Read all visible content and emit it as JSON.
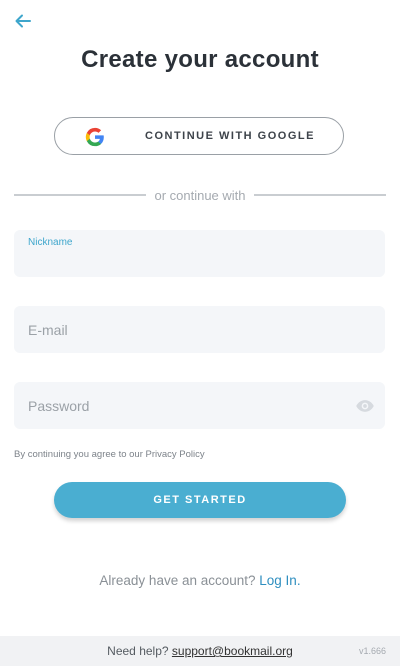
{
  "header": {
    "back_icon": "arrow-left-icon",
    "title": "Create your account"
  },
  "google_button": {
    "icon": "google-logo-icon",
    "label": "CONTINUE WITH GOOGLE"
  },
  "divider": {
    "text": "or continue with"
  },
  "form": {
    "nickname": {
      "label": "Nickname",
      "value": ""
    },
    "email": {
      "placeholder": "E-mail",
      "value": ""
    },
    "password": {
      "placeholder": "Password",
      "value": "",
      "toggle_icon": "eye-icon"
    },
    "terms_text": "By continuing you agree to our Privacy Policy"
  },
  "cta": {
    "label": "GET STARTED"
  },
  "signin": {
    "prompt": "Already have an account?",
    "link": "Log In."
  },
  "footer": {
    "help_text": "Need help?",
    "help_link": "support@bookmail.org",
    "version": "v1.666"
  },
  "colors": {
    "accent": "#4aaed1",
    "link": "#2f8fc0",
    "field_bg": "#f4f6f9",
    "title": "#2b3138"
  }
}
